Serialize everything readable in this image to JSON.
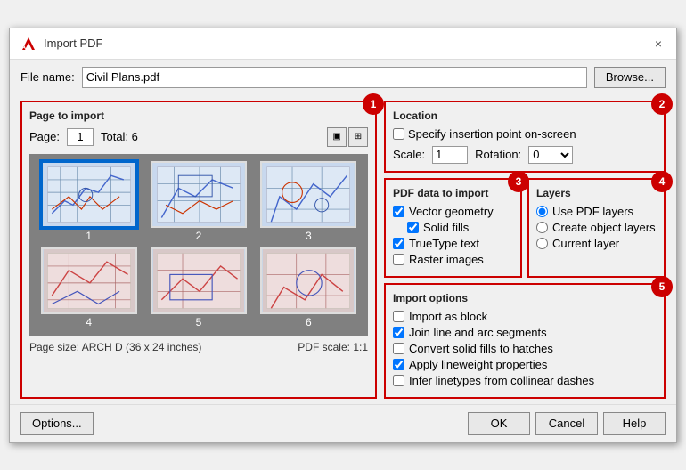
{
  "dialog": {
    "title": "Import PDF",
    "close_label": "×",
    "icon_label": "A"
  },
  "file_row": {
    "label": "File name:",
    "value": "Civil Plans.pdf",
    "browse_label": "Browse..."
  },
  "left_panel": {
    "title": "Page to import",
    "page_label": "Page:",
    "page_value": "1",
    "total_label": "Total:  6",
    "thumbnails": [
      {
        "id": 1,
        "label": "1",
        "selected": true
      },
      {
        "id": 2,
        "label": "2",
        "selected": false
      },
      {
        "id": 3,
        "label": "3",
        "selected": false
      },
      {
        "id": 4,
        "label": "4",
        "selected": false
      },
      {
        "id": 5,
        "label": "5",
        "selected": false
      },
      {
        "id": 6,
        "label": "6",
        "selected": false
      }
    ],
    "page_size_label": "Page size:  ARCH D (36 x 24 inches)",
    "pdf_scale_label": "PDF scale: 1:1",
    "badge": "1"
  },
  "location": {
    "title": "Location",
    "badge": "2",
    "specify_label": "Specify insertion point on-screen",
    "scale_label": "Scale:",
    "scale_value": "1",
    "rotation_label": "Rotation:",
    "rotation_value": "0"
  },
  "pdf_data": {
    "title": "PDF data to import",
    "badge": "3",
    "items": [
      {
        "label": "Vector geometry",
        "checked": true,
        "indent": false
      },
      {
        "label": "Solid fills",
        "checked": true,
        "indent": true
      },
      {
        "label": "TrueType text",
        "checked": true,
        "indent": false
      },
      {
        "label": "Raster images",
        "checked": false,
        "indent": false
      }
    ]
  },
  "layers": {
    "title": "Layers",
    "badge": "4",
    "options": [
      {
        "label": "Use PDF layers",
        "selected": true
      },
      {
        "label": "Create object layers",
        "selected": false
      },
      {
        "label": "Current layer",
        "selected": false
      }
    ]
  },
  "import_options": {
    "title": "Import options",
    "badge": "5",
    "items": [
      {
        "label": "Import as block",
        "checked": false
      },
      {
        "label": "Join line and arc segments",
        "checked": true
      },
      {
        "label": "Convert solid fills to hatches",
        "checked": false
      },
      {
        "label": "Apply lineweight properties",
        "checked": true
      },
      {
        "label": "Infer linetypes from collinear dashes",
        "checked": false
      }
    ]
  },
  "buttons": {
    "options_label": "Options...",
    "ok_label": "OK",
    "cancel_label": "Cancel",
    "help_label": "Help"
  }
}
